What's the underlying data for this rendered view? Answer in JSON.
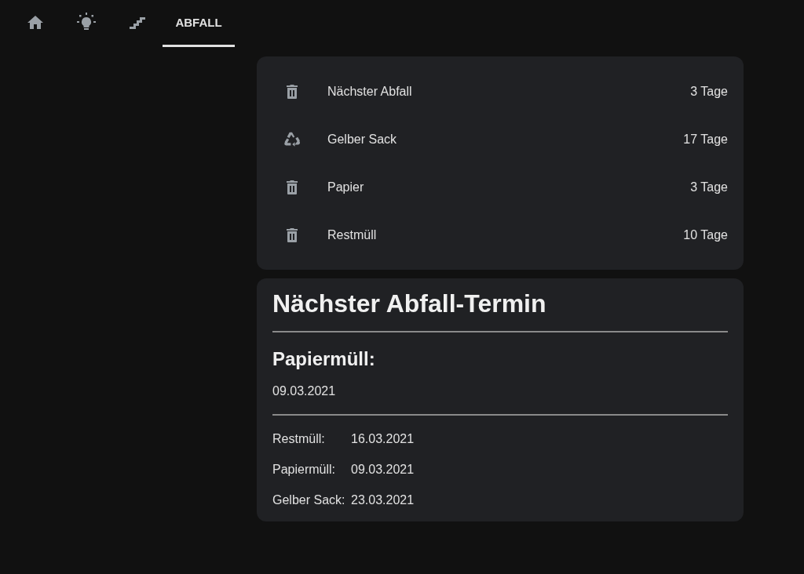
{
  "tabs": [
    {
      "kind": "home",
      "selected": false
    },
    {
      "kind": "bulb",
      "selected": false
    },
    {
      "kind": "stairs",
      "selected": false
    },
    {
      "kind": "text",
      "label": "ABFALL",
      "selected": true
    }
  ],
  "entities": [
    {
      "kind": "trash",
      "name": "Nächster Abfall",
      "state": "3 Tage"
    },
    {
      "kind": "recycle",
      "name": "Gelber Sack",
      "state": "17 Tage"
    },
    {
      "kind": "trash",
      "name": "Papier",
      "state": "3 Tage"
    },
    {
      "kind": "trash",
      "name": "Restmüll",
      "state": "10 Tage"
    }
  ],
  "markdown": {
    "title": "Nächster Abfall-Termin",
    "subtitle": "Papiermüll:",
    "date": "09.03.2021",
    "lines": [
      {
        "label": "Restmüll:",
        "value": "16.03.2021"
      },
      {
        "label": "Papiermüll:",
        "value": "09.03.2021"
      },
      {
        "label": "Gelber Sack:",
        "value": "23.03.2021"
      }
    ]
  }
}
